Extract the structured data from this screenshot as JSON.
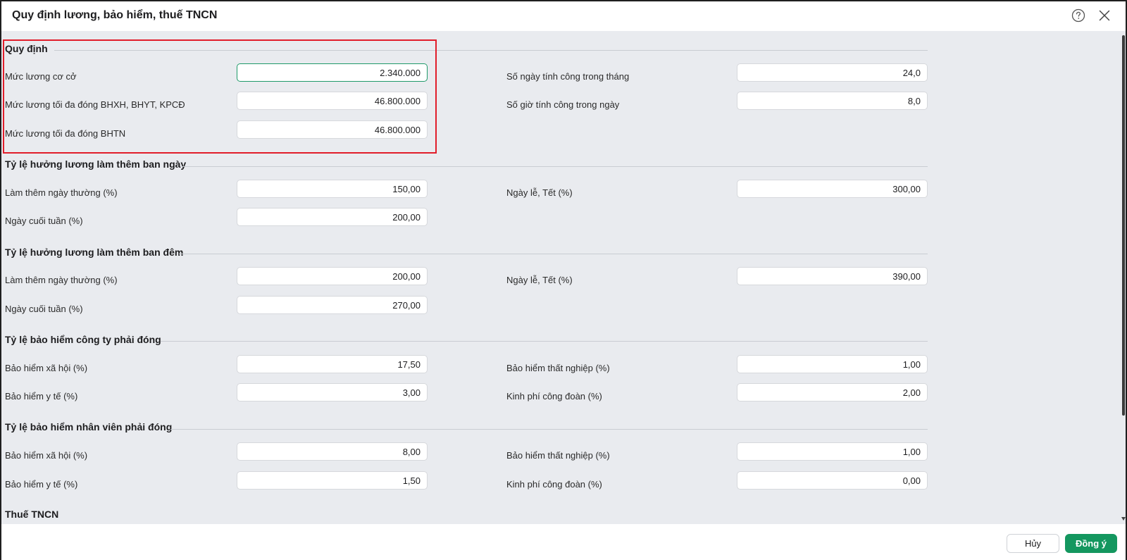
{
  "dialog": {
    "title": "Quy định lương, bảo hiểm, thuế TNCN",
    "help_icon": "help-circle-icon",
    "close_icon": "close-icon"
  },
  "sections": {
    "regulation": {
      "title": "Quy định",
      "base_salary": {
        "label": "Mức lương cơ cở",
        "value": "2.340.000"
      },
      "max_salary_bhxh": {
        "label": "Mức lương tối đa đóng BHXH, BHYT, KPCĐ",
        "value": "46.800.000"
      },
      "max_salary_bhtn": {
        "label": "Mức lương tối đa đóng BHTN",
        "value": "46.800.000"
      },
      "work_days_month": {
        "label": "Số ngày tính công trong tháng",
        "value": "24,0"
      },
      "work_hours_day": {
        "label": "Số giờ tính công trong ngày",
        "value": "8,0"
      }
    },
    "overtime_day": {
      "title": "Tỷ lệ hưởng lương làm thêm ban ngày",
      "weekday": {
        "label": "Làm thêm ngày thường (%)",
        "value": "150,00"
      },
      "weekend": {
        "label": "Ngày cuối tuần (%)",
        "value": "200,00"
      },
      "holiday": {
        "label": "Ngày lễ, Tết (%)",
        "value": "300,00"
      }
    },
    "overtime_night": {
      "title": "Tỷ lệ hưởng lương làm thêm ban đêm",
      "weekday": {
        "label": "Làm thêm ngày thường (%)",
        "value": "200,00"
      },
      "weekend": {
        "label": "Ngày cuối tuần (%)",
        "value": "270,00"
      },
      "holiday": {
        "label": "Ngày lễ, Tết (%)",
        "value": "390,00"
      }
    },
    "insurance_company": {
      "title": "Tỷ lệ bảo hiểm công ty phải đóng",
      "social": {
        "label": "Bảo hiểm xã hội (%)",
        "value": "17,50"
      },
      "health": {
        "label": "Bảo hiểm y tế (%)",
        "value": "3,00"
      },
      "unemployment": {
        "label": "Bảo hiểm thất nghiệp (%)",
        "value": "1,00"
      },
      "union": {
        "label": "Kinh phí công đoàn (%)",
        "value": "2,00"
      }
    },
    "insurance_employee": {
      "title": "Tỷ lệ bảo hiểm nhân viên phải đóng",
      "social": {
        "label": "Bảo hiểm xã hội (%)",
        "value": "8,00"
      },
      "health": {
        "label": "Bảo hiểm y tế (%)",
        "value": "1,50"
      },
      "unemployment": {
        "label": "Bảo hiểm thất nghiệp (%)",
        "value": "1,00"
      },
      "union": {
        "label": "Kinh phí công đoàn (%)",
        "value": "0,00"
      }
    },
    "tax": {
      "title": "Thuế TNCN"
    }
  },
  "footer": {
    "cancel_label": "Hủy",
    "ok_label": "Đồng ý"
  },
  "colors": {
    "accent": "#14975f",
    "highlight": "#e11d2a",
    "body_bg": "#e9ebef"
  }
}
